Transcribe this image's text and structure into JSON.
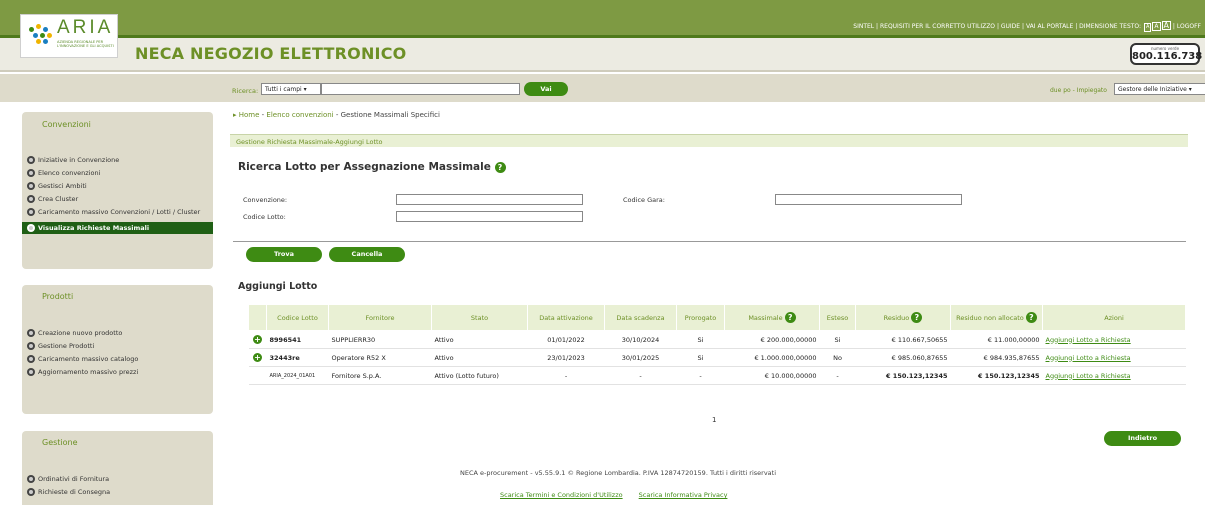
{
  "header": {
    "brand": "ARIA",
    "brand_sub": "AZIENDA REGIONALE PER L'INNOVAZIONE E GLI ACQUISTI",
    "app_title": "NECA NEGOZIO ELETTRONICO",
    "links": [
      "SINTEL",
      "REQUISITI PER IL CORRETTO UTILIZZO",
      "GUIDE",
      "VAI AL PORTALE",
      "DIMENSIONE TESTO:",
      "LOGOFF"
    ],
    "text_sizes": [
      "A",
      "A",
      "A"
    ],
    "phone_label": "numero verde",
    "phone": "800.116.738",
    "colors": {
      "primary_green": "#3e8b13",
      "header_green": "#7e9a43",
      "beige": "#dedbcb"
    }
  },
  "search": {
    "label": "Ricerca:",
    "field_select": "Tutti i campi",
    "value": "",
    "button": "Vai",
    "user_label": "due po - Impiegato",
    "role_select": "Gestore delle Iniziative"
  },
  "sidebar": {
    "convenzioni": {
      "title": "Convenzioni",
      "items": [
        "Iniziative in Convenzione",
        "Elenco convenzioni",
        "Gestisci Ambiti",
        "Crea Cluster",
        "Caricamento massivo Convenzioni / Lotti / Cluster",
        "Visualizza Richieste Massimali"
      ],
      "active_index": 5
    },
    "prodotti": {
      "title": "Prodotti",
      "items": [
        "Creazione nuovo prodotto",
        "Gestione Prodotti",
        "Caricamento massivo catalogo",
        "Aggiornamento massivo prezzi"
      ]
    },
    "gestione": {
      "title": "Gestione",
      "items": [
        "Ordinativi di Fornitura",
        "Richieste di Consegna"
      ]
    }
  },
  "breadcrumb": {
    "home": "Home",
    "level1": "Elenco convenzioni",
    "current": "Gestione Massimali Specifici",
    "sep": " - "
  },
  "section_bar": "Gestione Richiesta Massimale-Aggiungi Lotto",
  "form": {
    "title": "Ricerca Lotto per Assegnazione Massimale",
    "convenzione_label": "Convenzione:",
    "codice_gara_label": "Codice Gara:",
    "codice_lotto_label": "Codice Lotto:",
    "convenzione_value": "",
    "codice_gara_value": "",
    "codice_lotto_value": "",
    "find_button": "Trova",
    "cancel_button": "Cancella"
  },
  "table": {
    "title": "Aggiungi Lotto",
    "columns": [
      "",
      "Codice Lotto",
      "Fornitore",
      "Stato",
      "Data attivazione",
      "Data scadenza",
      "Prorogato",
      "Massimale",
      "Esteso",
      "Residuo",
      "Residuo non allocato",
      "Azioni"
    ],
    "rows": [
      {
        "plus": true,
        "codice": "8996541",
        "fornitore": "SUPPLIERR30",
        "stato": "Attivo",
        "attivazione": "01/01/2022",
        "scadenza": "30/10/2024",
        "prorogato": "Si",
        "massimale": "€ 200.000,00000",
        "esteso": "Si",
        "residuo": "€ 110.667,50655",
        "residuo_na": "€ 11.000,00000",
        "azione": "Aggiungi Lotto a Richiesta"
      },
      {
        "plus": true,
        "codice": "32443re",
        "fornitore": "Operatore R52 X",
        "stato": "Attivo",
        "attivazione": "23/01/2023",
        "scadenza": "30/01/2025",
        "prorogato": "Si",
        "massimale": "€ 1.000.000,00000",
        "esteso": "No",
        "residuo": "€ 985.060,87655",
        "residuo_na": "€ 984.935,87655",
        "azione": "Aggiungi Lotto a Richiesta"
      },
      {
        "plus": false,
        "codice": "ARIA_2024_01A01",
        "fornitore": "Fornitore S.p.A.",
        "stato": "Attivo (Lotto futuro)",
        "attivazione": "-",
        "scadenza": "-",
        "prorogato": "-",
        "massimale": "€ 10.000,00000",
        "esteso": "-",
        "residuo": "€ 150.123,12345",
        "residuo_na": "€ 150.123,12345",
        "azione": "Aggiungi Lotto a Richiesta"
      }
    ],
    "page": "1",
    "back_button": "Indietro"
  },
  "footer": {
    "text": "NECA e-procurement - v5.55.9.1 © Regione Lombardia. P.IVA 12874720159. Tutti i diritti riservati",
    "links": [
      "Scarica Termini e Condizioni d'Utilizzo",
      "Scarica Informativa Privacy"
    ]
  }
}
